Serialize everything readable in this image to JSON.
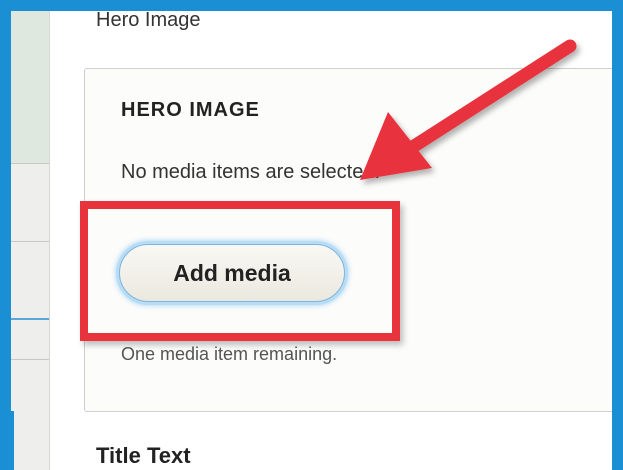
{
  "field": {
    "label": "Hero Image",
    "fieldset_title": "HERO IMAGE",
    "empty_message": "No media items are selected.",
    "add_button_label": "Add media",
    "remaining_message": "One media item remaining."
  },
  "next_field": {
    "label": "Title Text"
  },
  "colors": {
    "frame": "#1a8fd4",
    "annotation": "#e8323c",
    "button_glow": "#9fd0f3"
  }
}
